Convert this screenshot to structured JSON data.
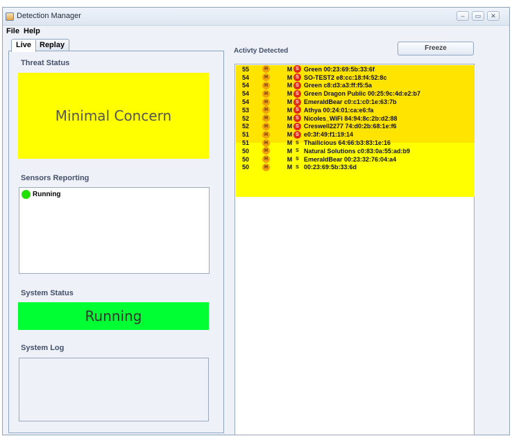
{
  "window": {
    "title": "Detection Manager",
    "controls": [
      "–",
      "▭",
      "✕"
    ]
  },
  "menu": {
    "file": "File",
    "help": "Help"
  },
  "tabs": {
    "live": "Live",
    "replay": "Replay"
  },
  "threat": {
    "label": "Threat Status",
    "value": "Minimal Concern",
    "color": "#ffff00"
  },
  "sensors": {
    "label": "Sensors Reporting",
    "items": [
      {
        "status": "Running",
        "color": "#22dd00"
      }
    ]
  },
  "system": {
    "label": "System Status",
    "value": "Running",
    "color": "#00ff33"
  },
  "log": {
    "label": "System Log"
  },
  "activity": {
    "label": "Activty Detected",
    "freeze_label": "Freeze",
    "rows": [
      {
        "score": "55",
        "h": "H",
        "m": "M",
        "s": "S",
        "s_red": true,
        "name": "Green  00:23:69:5b:33:6f"
      },
      {
        "score": "54",
        "h": "H",
        "m": "M",
        "s": "S",
        "s_red": true,
        "name": "SO-TEST2  e8:cc:18:f4:52:8c"
      },
      {
        "score": "54",
        "h": "H",
        "m": "M",
        "s": "S",
        "s_red": true,
        "name": "Green  c8:d3:a3:ff:f5:5a"
      },
      {
        "score": "54",
        "h": "H",
        "m": "M",
        "s": "S",
        "s_red": true,
        "name": "Green Dragon Public  00:25:9c:4d:e2:b7"
      },
      {
        "score": "54",
        "h": "H",
        "m": "M",
        "s": "S",
        "s_red": true,
        "name": "EmeraldBear  c0:c1:c0:1e:63:7b"
      },
      {
        "score": "53",
        "h": "H",
        "m": "M",
        "s": "S",
        "s_red": true,
        "name": "Athya  00:24:01:ca:e6:fa"
      },
      {
        "score": "52",
        "h": "H",
        "m": "M",
        "s": "S",
        "s_red": true,
        "name": "Nicoles_WiFi  84:94:8c:2b:d2:88"
      },
      {
        "score": "52",
        "h": "H",
        "m": "M",
        "s": "S",
        "s_red": true,
        "name": "Creswell2277  74:d0:2b:68:1e:f6"
      },
      {
        "score": "51",
        "h": "H",
        "m": "M",
        "s": "S",
        "s_red": true,
        "name": "        e0:3f:49:f1:19:14"
      },
      {
        "score": "51",
        "h": "H",
        "m": "M",
        "s": "S",
        "s_red": false,
        "name": "Thailicious  64:66:b3:83:1e:16"
      },
      {
        "score": "50",
        "h": "H",
        "m": "M",
        "s": "S",
        "s_red": false,
        "name": "Natural Solutions  c0:83:0a:55:ad:b9"
      },
      {
        "score": "50",
        "h": "H",
        "m": "M",
        "s": "S",
        "s_red": false,
        "name": "EmeraldBear  00:23:32:76:04:a4"
      },
      {
        "score": "50",
        "h": "H",
        "m": "M",
        "s": "S",
        "s_red": false,
        "name": "   00:23:69:5b:33:6d"
      }
    ]
  }
}
